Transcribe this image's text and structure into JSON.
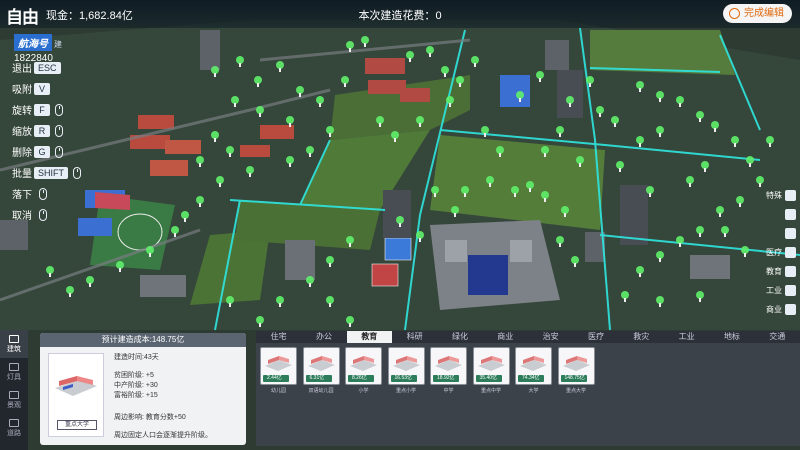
{
  "app": {
    "logo": "自由"
  },
  "topbar": {
    "funds_label": "现金：",
    "funds_value": "1,682.84亿",
    "build_cost_label": "本次建造花费：",
    "build_cost_value": "0",
    "finish_label": "完成编辑"
  },
  "city": {
    "name": "航海号",
    "tag": "建",
    "population": "1822840"
  },
  "controls": [
    {
      "label": "退出",
      "key": "ESC"
    },
    {
      "label": "吸附",
      "key": "V"
    },
    {
      "label": "旋转",
      "key": "F"
    },
    {
      "label": "缩放",
      "key": "R"
    },
    {
      "label": "删除",
      "key": "G"
    },
    {
      "label": "批量",
      "key": "SHIFT"
    },
    {
      "label": "落下",
      "key": ""
    },
    {
      "label": "取消",
      "key": ""
    }
  ],
  "right_tools": [
    {
      "label": "特殊"
    },
    {
      "label": ""
    },
    {
      "label": ""
    },
    {
      "label": "医疗"
    },
    {
      "label": "教育"
    },
    {
      "label": "工业"
    },
    {
      "label": "商业"
    }
  ],
  "left_nav": [
    {
      "label": "建筑"
    },
    {
      "label": "灯具"
    },
    {
      "label": "景观"
    },
    {
      "label": "道路"
    }
  ],
  "info_panel": {
    "title": "预计建造成本:148.75亿",
    "build_time": "建造时间:43天",
    "poor": "贫困阶级: +5",
    "middle": "中产阶级: +30",
    "rich": "富裕阶级: +15",
    "effect": "周边影响: 教育分数+50",
    "note": "周边固定人口会逐渐提升阶级。",
    "image_label": "重点大学"
  },
  "categories": [
    "住宅",
    "办公",
    "教育",
    "科研",
    "绿化",
    "商业",
    "治安",
    "医疗",
    "救灾",
    "工业",
    "地标",
    "交通"
  ],
  "active_category": "教育",
  "items": [
    {
      "name": "幼儿园",
      "price": "2.44亿"
    },
    {
      "name": "双语幼儿园",
      "price": "6.31亿"
    },
    {
      "name": "小学",
      "price": "8.26亿"
    },
    {
      "name": "重点小学",
      "price": "16.53亿"
    },
    {
      "name": "中学",
      "price": "18.92亿"
    },
    {
      "name": "重点中学",
      "price": "35.40亿"
    },
    {
      "name": "大学",
      "price": "74.34亿"
    },
    {
      "name": "重点大学",
      "price": "148.75亿"
    }
  ],
  "colors": {
    "accent_orange": "#e06a10",
    "road_cyan": "#2fe6e0",
    "tree_green": "#5ff06a",
    "city_name_bg": "#2a6fd0"
  }
}
